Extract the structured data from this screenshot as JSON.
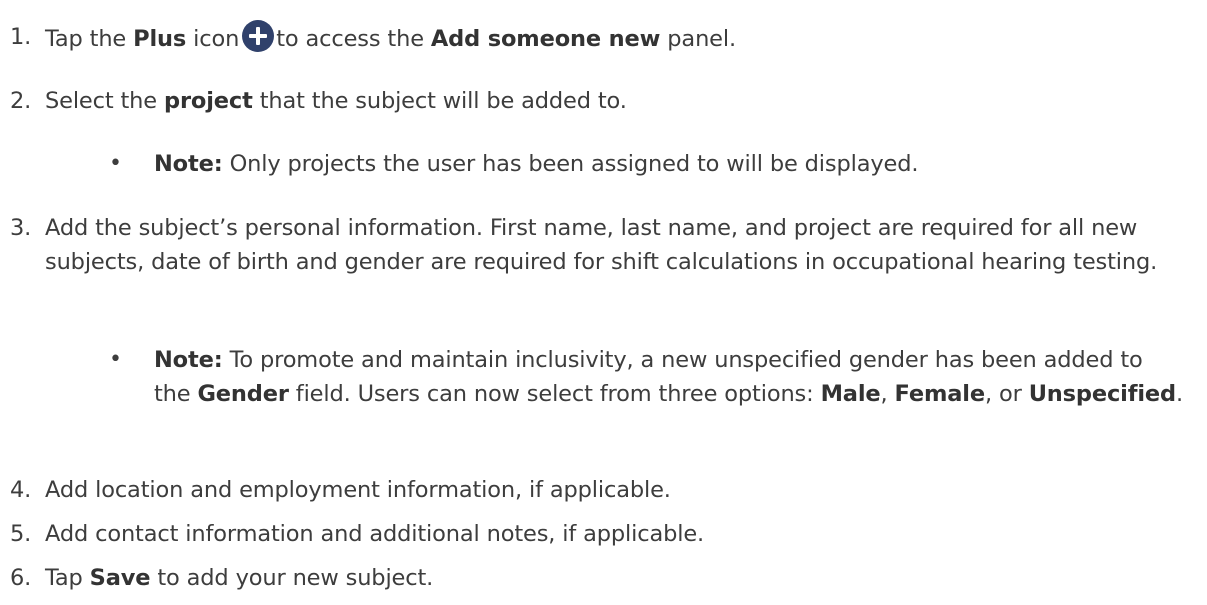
{
  "icons": {
    "plus": "plus-circle-icon",
    "plus_color": "#30416b"
  },
  "steps": [
    {
      "num": "1.",
      "p1": "Tap the ",
      "b1": "Plus",
      "p2": " icon",
      "p3": "to access the ",
      "b2": "Add someone new",
      "p4": " panel."
    },
    {
      "num": "2.",
      "p1": "Select the ",
      "b1": "project",
      "p2": " that the subject will be added to."
    },
    {
      "num": "3.",
      "text": "Add the subject’s personal information. First name, last name, and project are required for all new subjects, date of birth and gender are required for shift calculations in occupational hearing testing."
    },
    {
      "num": "4.",
      "text": "Add location and employment information, if applicable."
    },
    {
      "num": "5.",
      "text": "Add contact information and additional notes, if applicable."
    },
    {
      "num": "6.",
      "p1": "Tap ",
      "b1": "Save",
      "p2": " to add your new subject."
    }
  ],
  "notes": [
    {
      "bullet": "•",
      "label": "Note:",
      "text": " Only projects the user has been assigned to will be displayed."
    },
    {
      "bullet": "•",
      "label": "Note:",
      "p1": " To promote and maintain inclusivity, a new unspecified gender has been added to the ",
      "b1": "Gender",
      "p2": " field. Users can now select from three options: ",
      "b2": "Male",
      "p3": ", ",
      "b3": "Female",
      "p4": ", or ",
      "b4": "Unspecified",
      "p5": "."
    }
  ]
}
